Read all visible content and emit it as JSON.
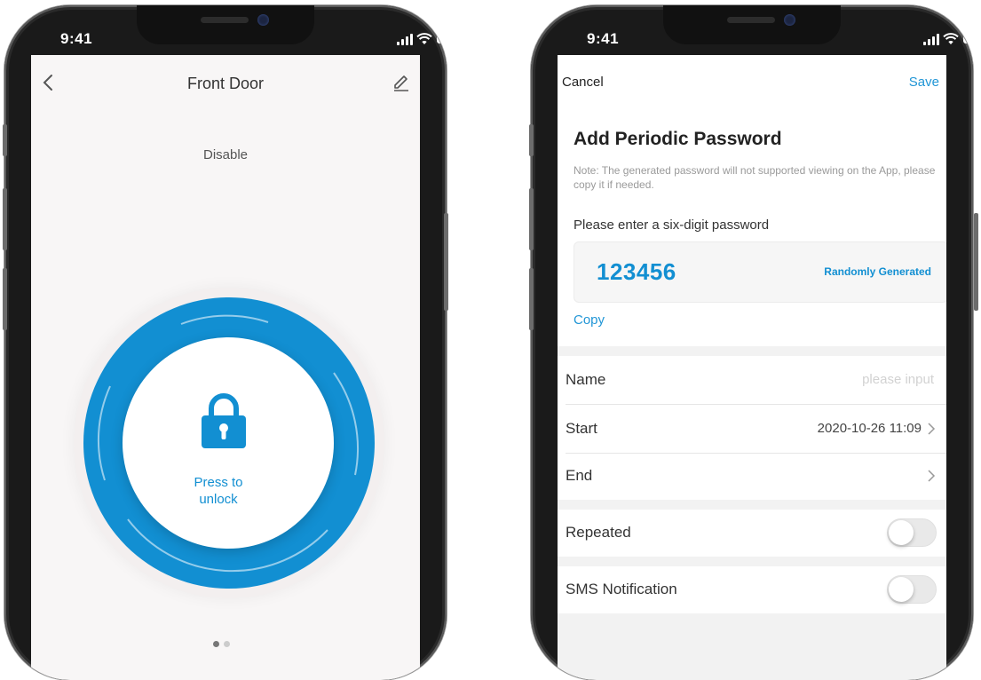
{
  "status_bar": {
    "time": "9:41"
  },
  "lock_screen": {
    "title": "Front Door",
    "status_text": "Disable",
    "unlock_label": "Press to\nunlock",
    "page_indicator": {
      "total": 2,
      "active": 1
    },
    "colors": {
      "ring": "#128fd2",
      "background": "#f8f6f6"
    }
  },
  "password_screen": {
    "cancel_label": "Cancel",
    "save_label": "Save",
    "title": "Add Periodic Password",
    "note": "Note: The generated password will not supported viewing on the App, please copy it if needed.",
    "password_prompt": "Please enter a six-digit password",
    "password_value": "123456",
    "random_label": "Randomly Generated",
    "copy_label": "Copy",
    "name": {
      "label": "Name",
      "placeholder": "please input"
    },
    "start": {
      "label": "Start",
      "value": "2020-10-26 11:09"
    },
    "end": {
      "label": "End",
      "value": ""
    },
    "repeated": {
      "label": "Repeated",
      "enabled": false
    },
    "sms": {
      "label": "SMS Notification",
      "enabled": false
    },
    "colors": {
      "accent": "#2196d6"
    }
  },
  "icons": [
    "back-arrow-icon",
    "edit-pencil-icon",
    "padlock-icon",
    "chevron-right-icon",
    "signal-icon",
    "wifi-icon",
    "battery-icon"
  ]
}
